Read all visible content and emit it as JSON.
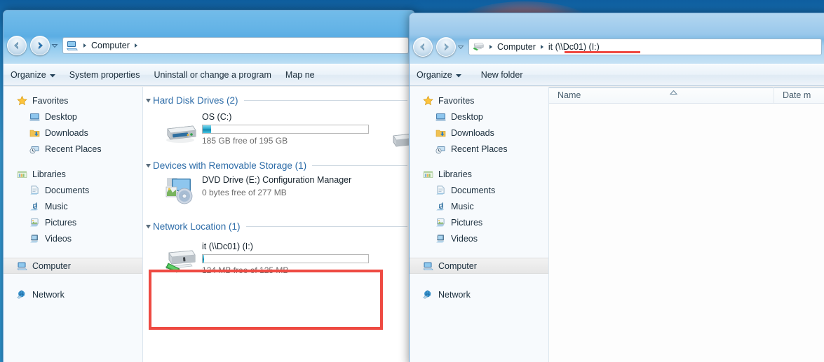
{
  "desktop": {
    "background_color": "#2f9ad9"
  },
  "annotation": {
    "box_color": "#ee4a42",
    "underline_color": "#ef4a42",
    "blob_color": "#e2604a"
  },
  "window1": {
    "title": "",
    "nav": {
      "back_label": "Back",
      "forward_label": "Forward",
      "recent_label": "Recent pages"
    },
    "address": {
      "icon": "computer-icon",
      "crumbs": [
        "Computer"
      ],
      "trailing_separator": true
    },
    "toolbar": {
      "items": [
        {
          "label": "Organize",
          "has_caret": true
        },
        {
          "label": "System properties",
          "has_caret": false
        },
        {
          "label": "Uninstall or change a program",
          "has_caret": false
        },
        {
          "label": "Map ne",
          "has_caret": false
        }
      ]
    },
    "navpane": {
      "groups": [
        {
          "header": {
            "label": "Favorites",
            "icon": "star-icon"
          },
          "items": [
            {
              "label": "Desktop",
              "icon": "desktop-icon"
            },
            {
              "label": "Downloads",
              "icon": "downloads-icon"
            },
            {
              "label": "Recent Places",
              "icon": "recent-places-icon"
            }
          ]
        },
        {
          "header": {
            "label": "Libraries",
            "icon": "libraries-icon"
          },
          "items": [
            {
              "label": "Documents",
              "icon": "documents-icon"
            },
            {
              "label": "Music",
              "icon": "music-icon"
            },
            {
              "label": "Pictures",
              "icon": "pictures-icon"
            },
            {
              "label": "Videos",
              "icon": "videos-icon"
            }
          ]
        },
        {
          "header": {
            "label": "Computer",
            "icon": "computer-icon",
            "selected": true
          },
          "items": []
        },
        {
          "header": {
            "label": "Network",
            "icon": "network-icon"
          },
          "items": []
        }
      ]
    },
    "content": {
      "groups": [
        {
          "title": "Hard Disk Drives (2)",
          "expanded": true,
          "drives": [
            {
              "name": "OS (C:)",
              "icon": "hard-drive-icon",
              "free_text": "185 GB free of 195 GB",
              "used_percent": 5,
              "show_bar": true
            }
          ]
        },
        {
          "title": "Devices with Removable Storage (1)",
          "expanded": true,
          "drives": [
            {
              "name": "DVD Drive (E:) Configuration Manager",
              "icon": "dvd-drive-icon",
              "free_text": "0 bytes free of 277 MB",
              "used_percent": 100,
              "show_bar": false
            }
          ]
        },
        {
          "title": "Network Location (1)",
          "expanded": true,
          "drives": [
            {
              "name": "it (\\\\Dc01) (I:)",
              "icon": "network-drive-icon",
              "free_text": "124 MB free of 125 MB",
              "used_percent": 1,
              "show_bar": true,
              "annotated": true
            }
          ]
        }
      ]
    }
  },
  "window2": {
    "title": "",
    "nav": {
      "back_label": "Back",
      "forward_label": "Forward",
      "recent_label": "Recent pages"
    },
    "address": {
      "icon": "network-drive-icon",
      "crumbs": [
        "Computer",
        "it (\\\\Dc01) (I:)"
      ],
      "underlined_crumb_index": 1
    },
    "toolbar": {
      "items": [
        {
          "label": "Organize",
          "has_caret": true
        },
        {
          "label": "New folder",
          "has_caret": false
        }
      ]
    },
    "navpane": {
      "groups": [
        {
          "header": {
            "label": "Favorites",
            "icon": "star-icon"
          },
          "items": [
            {
              "label": "Desktop",
              "icon": "desktop-icon"
            },
            {
              "label": "Downloads",
              "icon": "downloads-icon"
            },
            {
              "label": "Recent Places",
              "icon": "recent-places-icon"
            }
          ]
        },
        {
          "header": {
            "label": "Libraries",
            "icon": "libraries-icon"
          },
          "items": [
            {
              "label": "Documents",
              "icon": "documents-icon"
            },
            {
              "label": "Music",
              "icon": "music-icon"
            },
            {
              "label": "Pictures",
              "icon": "pictures-icon"
            },
            {
              "label": "Videos",
              "icon": "videos-icon"
            }
          ]
        },
        {
          "header": {
            "label": "Computer",
            "icon": "computer-icon",
            "selected": true
          },
          "items": []
        },
        {
          "header": {
            "label": "Network",
            "icon": "network-icon"
          },
          "items": []
        }
      ]
    },
    "columns": [
      {
        "label": "Name",
        "sorted": "asc"
      },
      {
        "label": "Date m",
        "sorted": ""
      }
    ],
    "files": []
  }
}
